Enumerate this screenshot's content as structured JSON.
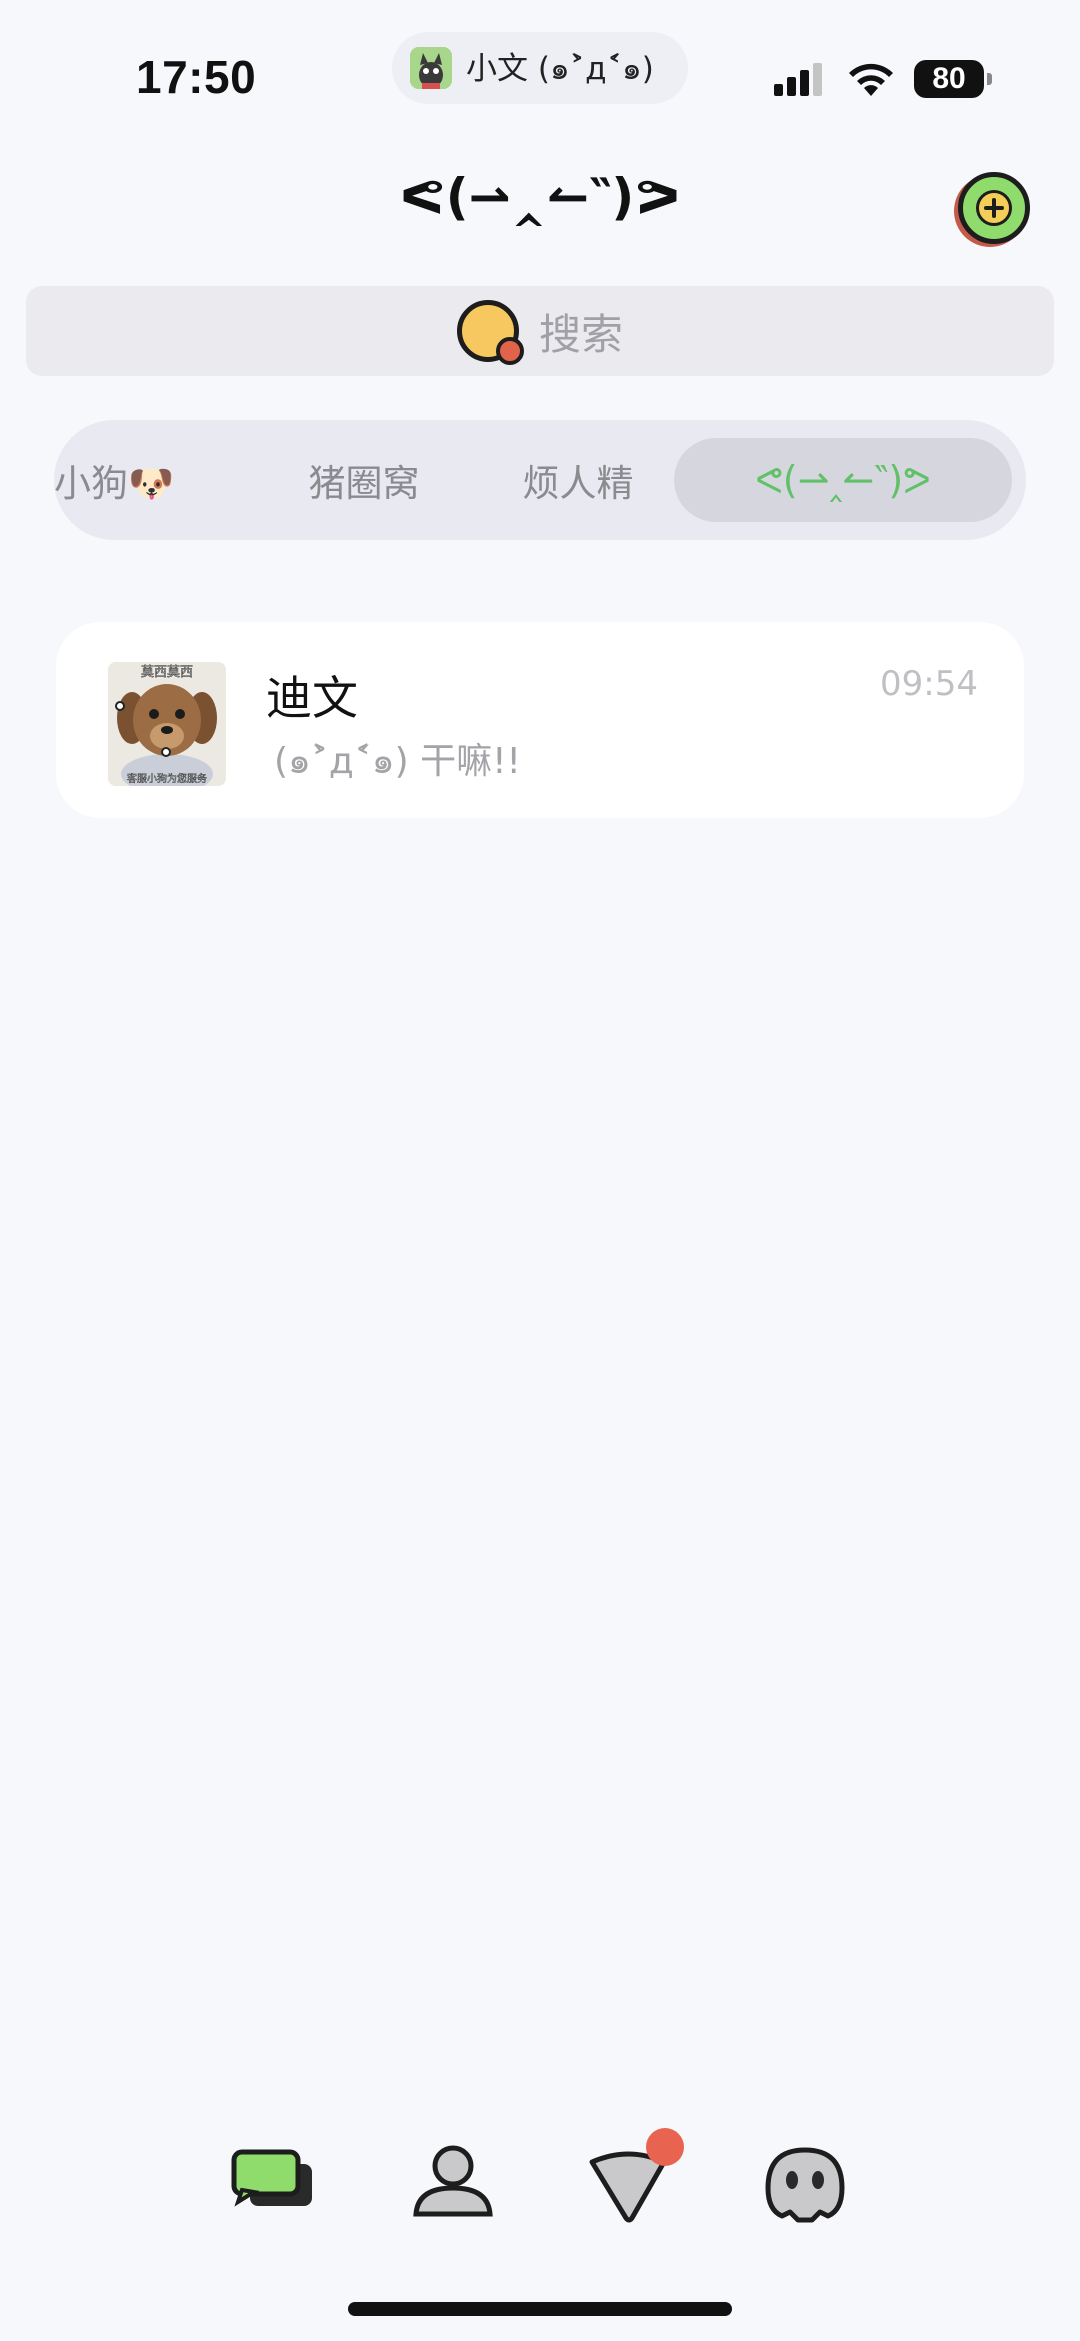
{
  "status_bar": {
    "time": "17:50",
    "island_label": "小文 (๑˃̀д˂́๑)",
    "battery": "80"
  },
  "header": {
    "title": "ᕙ(⇀‸↼‶)ᕗ"
  },
  "search": {
    "placeholder": "搜索"
  },
  "tabs": [
    {
      "label": "小狗🐶"
    },
    {
      "label": "猪圈窝"
    },
    {
      "label": "烦人精"
    },
    {
      "label": "ᕙ(⇀‸↼‶)ᕗ",
      "active": true
    }
  ],
  "chats": [
    {
      "name": "迪文",
      "preview": "(๑˃̀д˂́๑) 干嘛!!",
      "time": "09:54",
      "avatar_caption_top": "莫西莫西",
      "avatar_caption_bottom": "客服小狗为您服务"
    }
  ],
  "bottom_nav": {
    "items": [
      "chats-icon",
      "contacts-icon",
      "discover-icon",
      "me-icon"
    ],
    "badge_color": "#e96450"
  },
  "colors": {
    "accent_green": "#62c06a",
    "background": "#f7f8fc"
  }
}
